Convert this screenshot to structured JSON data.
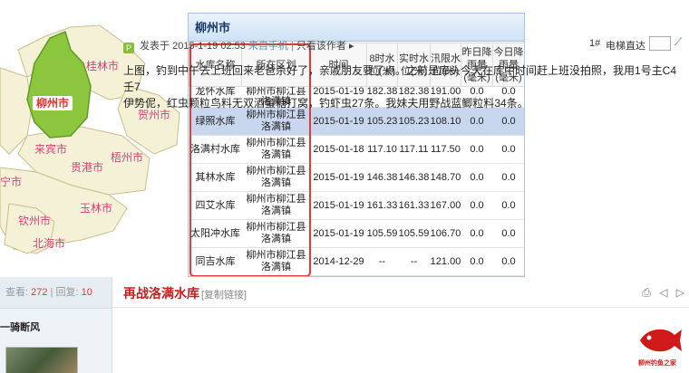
{
  "map": {
    "cities": [
      {
        "name": "桂林市",
        "highlight": false
      },
      {
        "name": "柳州市",
        "highlight": true
      },
      {
        "name": "贺州市",
        "highlight": false
      },
      {
        "name": "来宾市",
        "highlight": false
      },
      {
        "name": "梧州市",
        "highlight": false
      },
      {
        "name": "贵港市",
        "highlight": false
      },
      {
        "name": "宁市",
        "highlight": false
      },
      {
        "name": "玉林市",
        "highlight": false
      },
      {
        "name": "钦州市",
        "highlight": false
      },
      {
        "name": "北海市",
        "highlight": false
      }
    ],
    "colors": {
      "highlight_region": "#8cc63f",
      "region": "#f4f1d6",
      "border": "#c8c08a",
      "label": "#d43b5a"
    }
  },
  "panel": {
    "title": "柳州市",
    "headers": [
      "水库名称",
      "所在区划",
      "时间",
      "8时水位(米)",
      "实时水位(米)",
      "汛限水位(米)",
      "昨日降雨量(毫米)",
      "今日降雨量(毫米)"
    ],
    "rows": [
      [
        "龙怀水库",
        "柳州市柳江县洛满镇",
        "2015-01-19",
        "182.38",
        "182.38",
        "191.00",
        "0.0",
        "0.0"
      ],
      [
        "绿照水库",
        "柳州市柳江县洛满镇",
        "2015-01-19",
        "105.23",
        "105.23",
        "108.10",
        "0.0",
        "0.0"
      ],
      [
        "洛满村水库",
        "柳州市柳江县洛满镇",
        "2015-01-18",
        "117.10",
        "117.11",
        "117.50",
        "0.0",
        "0.0"
      ],
      [
        "其林水库",
        "柳州市柳江县洛满镇",
        "2015-01-19",
        "146.38",
        "146.38",
        "148.70",
        "0.0",
        "0.0"
      ],
      [
        "四艾水库",
        "柳州市柳江县洛满镇",
        "2015-01-19",
        "161.33",
        "161.33",
        "167.00",
        "0.0",
        "0.0"
      ],
      [
        "太阳冲水库",
        "柳州市柳江县洛满镇",
        "2015-01-19",
        "105.59",
        "105.59",
        "106.70",
        "0.0",
        "0.0"
      ],
      [
        "同吉水库",
        "柳州市柳江县洛满镇",
        "2014-12-29",
        "--",
        "--",
        "121.00",
        "0.0",
        "0.0"
      ]
    ],
    "selected_row": 1,
    "outline_color": "#e23a3a"
  },
  "forum": {
    "stats": {
      "view_label": "查看:",
      "views": "272",
      "sep": "|",
      "reply_label": "回复:",
      "replies": "10"
    },
    "thread_title": "再战洛满水库",
    "copy_link": "[复制链接]",
    "thread_icons": "⎙ ◁ ▷",
    "username": "一骑断风",
    "post_meta": {
      "icon": "P",
      "posted_at": "发表于 2015-1-19 02:53",
      "source": "来自手机",
      "sep": "|",
      "only_author": "只看该作者",
      "arrow": "▸"
    },
    "floor": "1#",
    "floor_jump": "电梯直达",
    "floor_go": "⟋",
    "post_lines": [
      "上图，钓到中午去上班回来老爸杀好了，亲戚朋友要了点。之前是库头今天在库中时间赶上班没拍照，我用1号主C4壬7",
      "伊势伲，红虫颗粒鸟料无双酒蜜糖打窝，钓虾虫27条。我妹夫用野战蓝鲫粒料34条。"
    ],
    "watermark": "柳州钓鱼之家"
  }
}
